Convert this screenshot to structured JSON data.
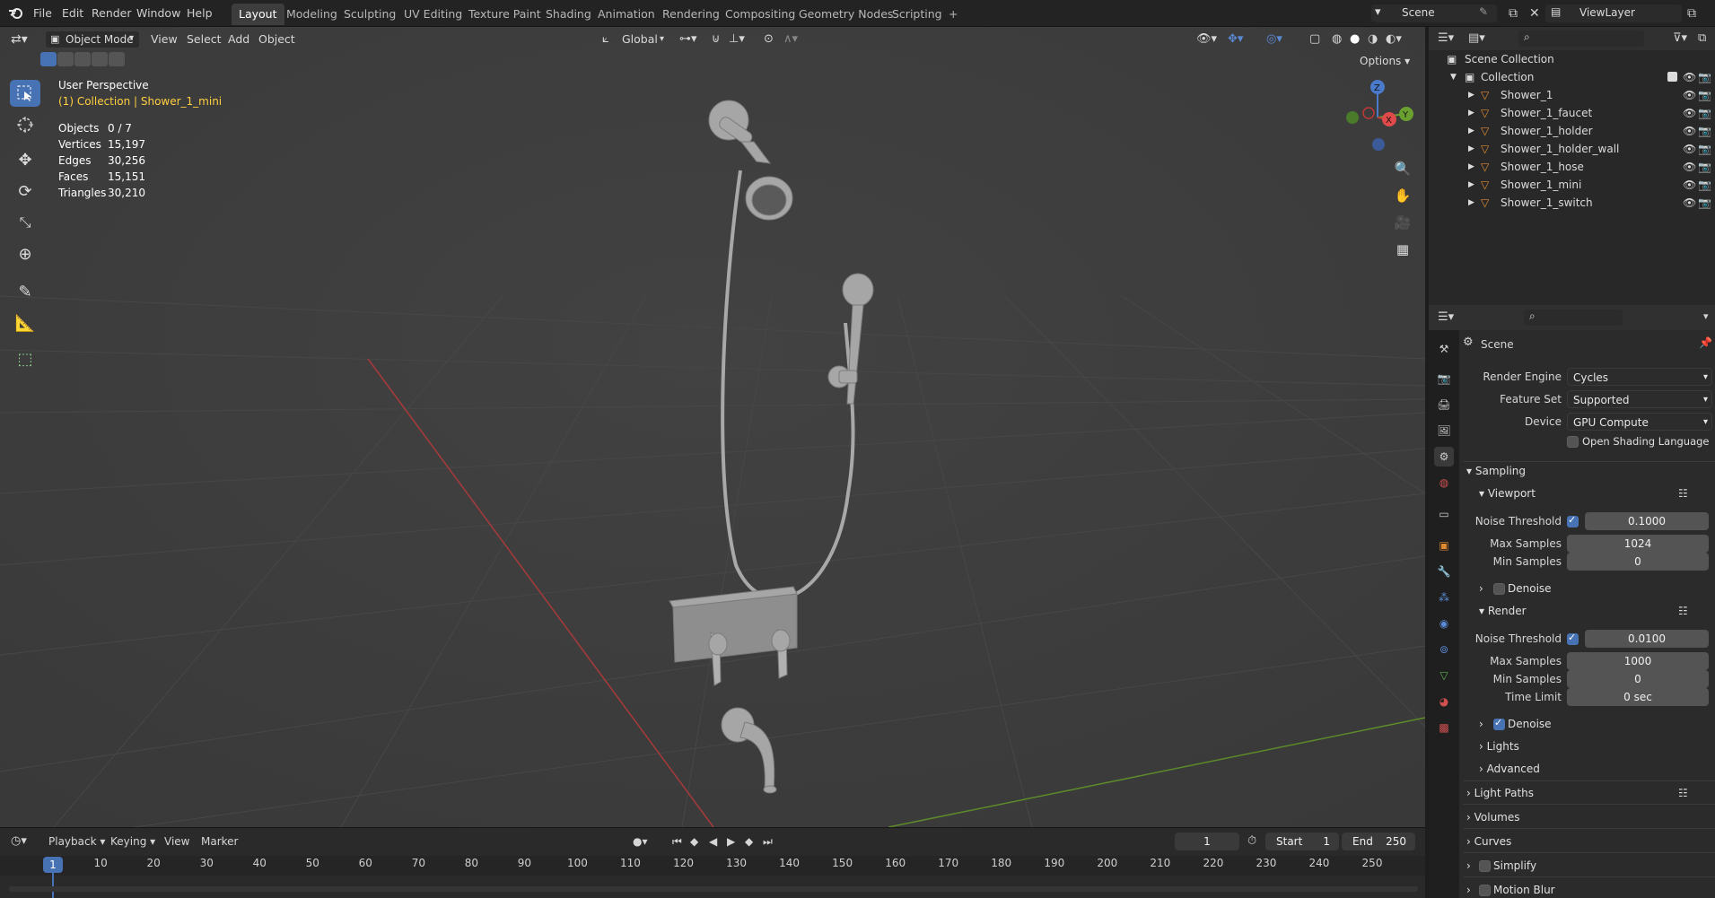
{
  "topbar": {
    "menus": [
      "File",
      "Edit",
      "Render",
      "Window",
      "Help"
    ],
    "workspaces": [
      "Layout",
      "Modeling",
      "Sculpting",
      "UV Editing",
      "Texture Paint",
      "Shading",
      "Animation",
      "Rendering",
      "Compositing",
      "Geometry Nodes",
      "Scripting",
      "+"
    ],
    "active_workspace": "Layout",
    "scene": "Scene",
    "view_layer": "ViewLayer"
  },
  "viewport_header": {
    "mode": "Object Mode",
    "menus": [
      "View",
      "Select",
      "Add",
      "Object"
    ],
    "orientation": "Global",
    "options": "Options"
  },
  "overlay": {
    "perspective": "User Perspective",
    "collection_line": "(1) Collection | Shower_1_mini",
    "stats": [
      {
        "label": "Objects",
        "value": "0 / 7"
      },
      {
        "label": "Vertices",
        "value": "15,197"
      },
      {
        "label": "Edges",
        "value": "30,256"
      },
      {
        "label": "Faces",
        "value": "15,151"
      },
      {
        "label": "Triangles",
        "value": "30,210"
      }
    ]
  },
  "gizmo": {
    "z": "Z",
    "x": "X",
    "y": "Y"
  },
  "outliner": {
    "root": "Scene Collection",
    "collection": "Collection",
    "items": [
      "Shower_1",
      "Shower_1_faucet",
      "Shower_1_holder",
      "Shower_1_holder_wall",
      "Shower_1_hose",
      "Shower_1_mini",
      "Shower_1_switch"
    ]
  },
  "properties": {
    "context": "Scene",
    "render_engine_label": "Render Engine",
    "render_engine": "Cycles",
    "feature_set_label": "Feature Set",
    "feature_set": "Supported",
    "device_label": "Device",
    "device": "GPU Compute",
    "osl_label": "Open Shading Language",
    "sampling": "Sampling",
    "viewport": {
      "title": "Viewport",
      "noise_threshold_label": "Noise Threshold",
      "noise_threshold": "0.1000",
      "max_samples_label": "Max Samples",
      "max_samples": "1024",
      "min_samples_label": "Min Samples",
      "min_samples": "0",
      "denoise_label": "Denoise"
    },
    "render": {
      "title": "Render",
      "noise_threshold_label": "Noise Threshold",
      "noise_threshold": "0.0100",
      "max_samples_label": "Max Samples",
      "max_samples": "1000",
      "min_samples_label": "Min Samples",
      "min_samples": "0",
      "time_limit_label": "Time Limit",
      "time_limit": "0 sec",
      "denoise_label": "Denoise"
    },
    "lights": "Lights",
    "advanced": "Advanced",
    "light_paths": "Light Paths",
    "volumes": "Volumes",
    "curves": "Curves",
    "simplify": "Simplify",
    "motion_blur": "Motion Blur"
  },
  "timeline": {
    "menus": [
      "Playback",
      "Keying",
      "View",
      "Marker"
    ],
    "current_frame": "1",
    "start_label": "Start",
    "start": "1",
    "end_label": "End",
    "end": "250",
    "ticks": [
      "1",
      "10",
      "20",
      "30",
      "40",
      "50",
      "60",
      "70",
      "80",
      "90",
      "100",
      "110",
      "120",
      "130",
      "140",
      "150",
      "160",
      "170",
      "180",
      "190",
      "200",
      "210",
      "220",
      "230",
      "240",
      "250"
    ]
  },
  "colors": {
    "accent": "#4772b3",
    "selected_text": "#ffcf40",
    "x_axis": "#c23b3b",
    "y_axis": "#6a9a2a"
  }
}
